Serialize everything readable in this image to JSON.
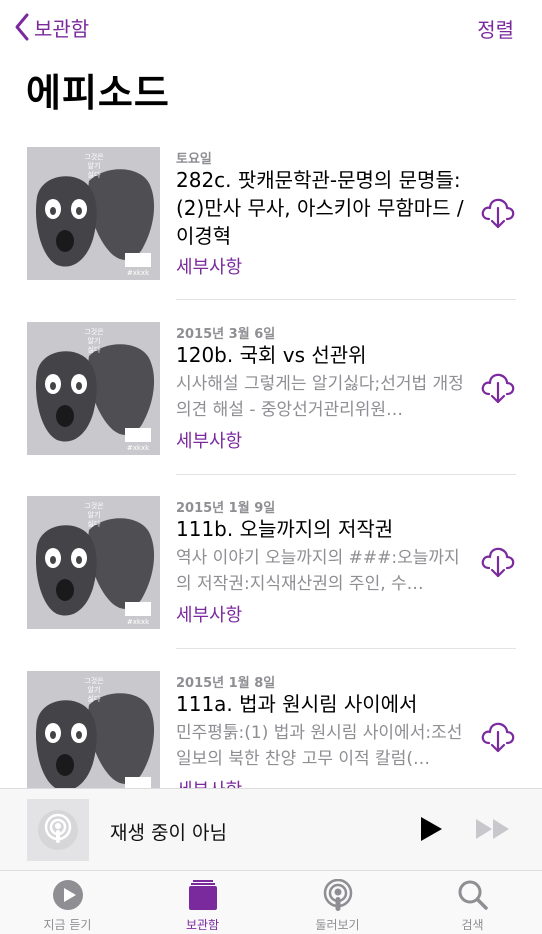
{
  "nav": {
    "back_label": "보관함",
    "sort_label": "정렬"
  },
  "page_title": "에피소드",
  "episodes": [
    {
      "date": "토요일",
      "title": "282c. 팟캐문학관-문명의 문명들:(2)만사 무사, 아스키아 무함마드 /이경혁",
      "description": "",
      "details": "세부사항"
    },
    {
      "date": "2015년 3월 6일",
      "title": "120b. 국회 vs 선관위",
      "description": "시사해설 그렇게는 알기싫다;선거법 개정 의견 해설 - 중앙선거관리위원…",
      "details": "세부사항"
    },
    {
      "date": "2015년 1월 9일",
      "title": "111b. 오늘까지의 저작권",
      "description": "역사 이야기 오늘까지의 ###:오늘까지의 저작권:지식재산권의 주인, 수…",
      "details": "세부사항"
    },
    {
      "date": "2015년 1월 8일",
      "title": "111a. 법과 원시림 사이에서",
      "description": "민주평툵:(1) 법과 원시림 사이에서:조선일보의 북한 찬양 고무 이적 칼럼(…",
      "details": "세부사항"
    }
  ],
  "artwork": {
    "line1": "그것은",
    "line2": "알기",
    "line3": "싫다",
    "tag": "#xkxk"
  },
  "player": {
    "status": "재생 중이 아님"
  },
  "tabs": [
    {
      "label": "지금 듣기",
      "icon": "play-circle-icon"
    },
    {
      "label": "보관함",
      "icon": "library-icon"
    },
    {
      "label": "둘러보기",
      "icon": "podcast-icon"
    },
    {
      "label": "검색",
      "icon": "search-icon"
    }
  ],
  "colors": {
    "accent": "#7b2a9e",
    "gray": "#8e8e93"
  }
}
